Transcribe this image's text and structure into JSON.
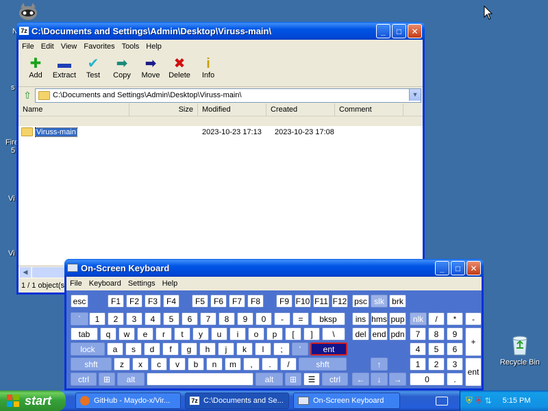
{
  "desktop": {
    "left_labels": [
      "N",
      "s",
      "Fire",
      "5",
      "Vi",
      "Vi"
    ],
    "recycle_bin_label": "Recycle Bin"
  },
  "sevenzip": {
    "title": "C:\\Documents and Settings\\Admin\\Desktop\\Viruss-main\\",
    "menu": [
      "File",
      "Edit",
      "View",
      "Favorites",
      "Tools",
      "Help"
    ],
    "toolbar": [
      {
        "label": "Add",
        "icon": "plus-icon",
        "color": "#1aa31a"
      },
      {
        "label": "Extract",
        "icon": "minus-icon",
        "color": "#1e3fb5"
      },
      {
        "label": "Test",
        "icon": "check-icon",
        "color": "#2ab3c9"
      },
      {
        "label": "Copy",
        "icon": "copy-arrow-icon",
        "color": "#1a8a7a"
      },
      {
        "label": "Move",
        "icon": "move-arrow-icon",
        "color": "#1a1a8a"
      },
      {
        "label": "Delete",
        "icon": "delete-x-icon",
        "color": "#d01010"
      },
      {
        "label": "Info",
        "icon": "info-icon",
        "color": "#c8a010"
      }
    ],
    "address": "C:\\Documents and Settings\\Admin\\Desktop\\Viruss-main\\",
    "columns": [
      "Name",
      "Size",
      "Modified",
      "Created",
      "Comment"
    ],
    "rows": [
      {
        "name": "Viruss-main",
        "size": "",
        "modified": "2023-10-23 17:13",
        "created": "2023-10-23 17:08",
        "comment": ""
      }
    ],
    "status": "1 / 1 object(s)"
  },
  "osk": {
    "title": "On-Screen Keyboard",
    "menu": [
      "File",
      "Keyboard",
      "Settings",
      "Help"
    ],
    "selected_key": "ent"
  },
  "taskbar": {
    "start_label": "start",
    "tasks": [
      "GitHub - Maydo-x/Vir...",
      "C:\\Documents and Se...",
      "On-Screen Keyboard"
    ],
    "clock": "5:15 PM"
  }
}
